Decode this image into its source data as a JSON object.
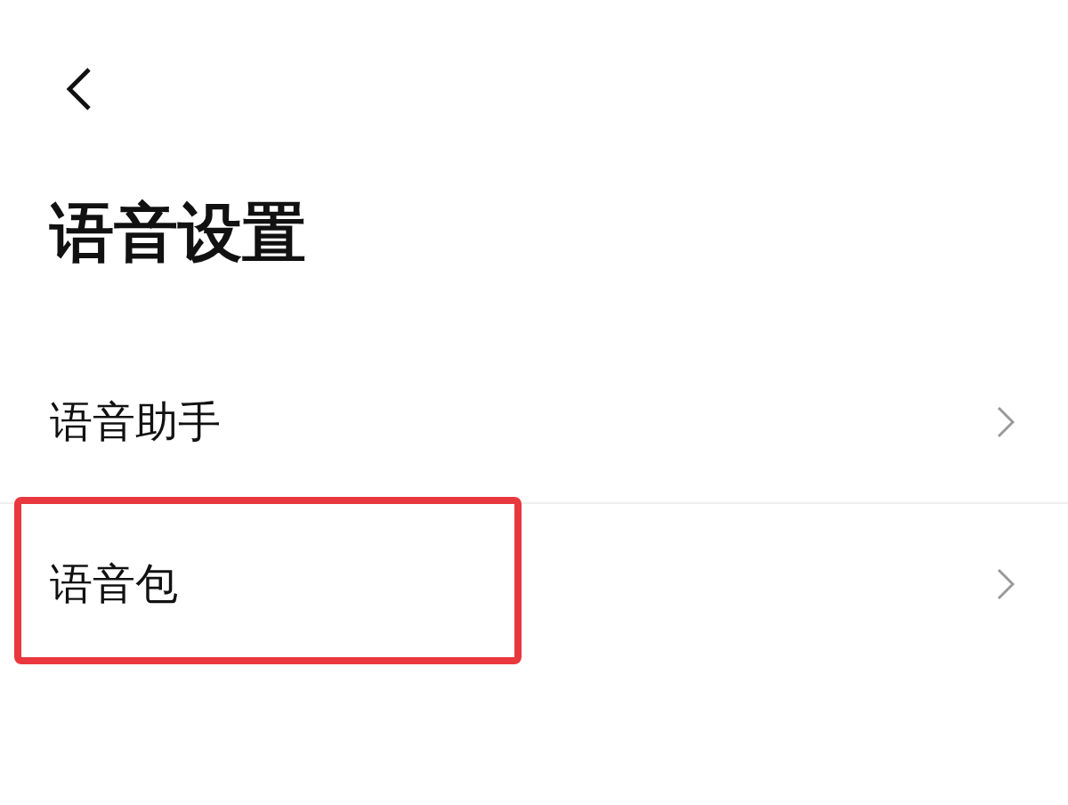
{
  "title": "语音设置",
  "items": [
    {
      "label": "语音助手",
      "highlighted": false
    },
    {
      "label": "语音包",
      "highlighted": true
    }
  ]
}
